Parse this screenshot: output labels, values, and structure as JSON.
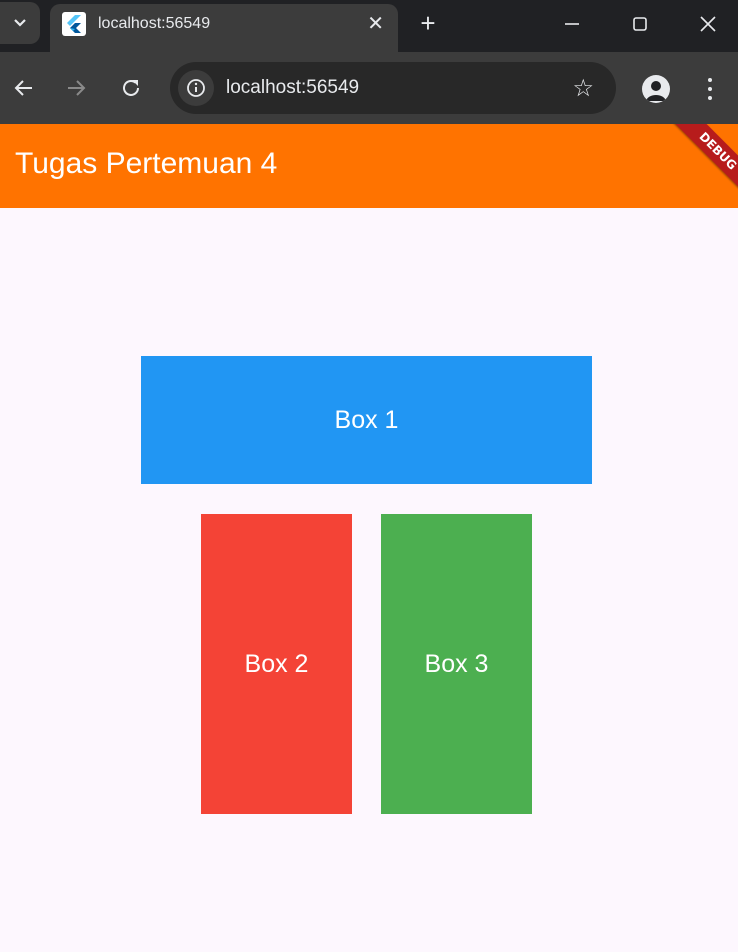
{
  "browser": {
    "tab_title": "localhost:56549",
    "url": "localhost:56549",
    "tab_favicon": "flutter-icon"
  },
  "app": {
    "title": "Tugas Pertemuan 4",
    "debug_banner": "DEBUG",
    "colors": {
      "appbar": "#ff7300",
      "background": "#fdf7fe",
      "box1": "#2196f3",
      "box2": "#f44336",
      "box3": "#4caf50"
    }
  },
  "boxes": [
    {
      "label": "Box 1"
    },
    {
      "label": "Box 2"
    },
    {
      "label": "Box 3"
    }
  ]
}
